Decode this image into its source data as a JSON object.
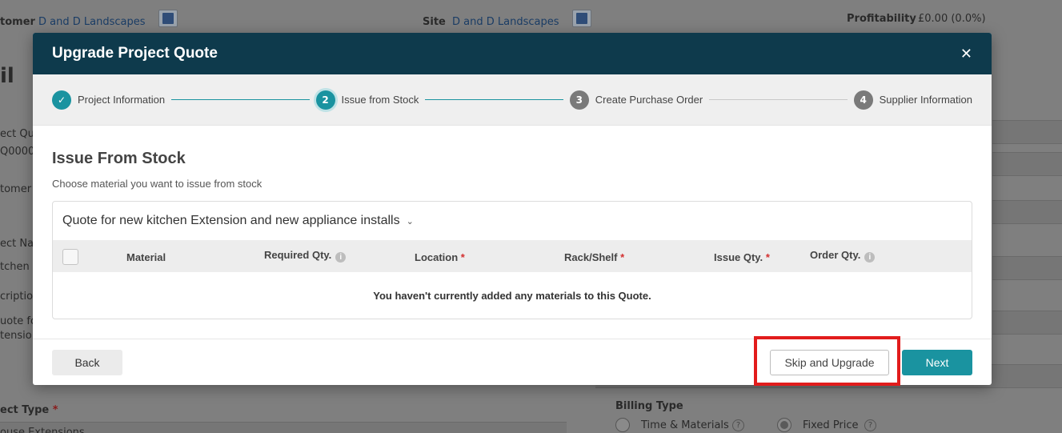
{
  "background": {
    "customer_label": "tomer",
    "customer_value": "D and D Landscapes",
    "site_label": "Site",
    "site_value": "D and D Landscapes",
    "profitability_label": "Profitability",
    "profitability_value": "£0.00 (0.0%)",
    "page_heading_fragment": "il",
    "left_fields": [
      "ect Qu",
      "Q0000",
      "tomer (",
      "ect Na",
      "tchen i",
      "criptio",
      "uote fo",
      "tensio"
    ],
    "project_type_label": "ect Type",
    "project_type_value": "ouse Extensions",
    "billing_type_label": "Billing Type",
    "billing_options": [
      "Time & Materials",
      "Fixed Price"
    ],
    "billing_selected": "Fixed Price"
  },
  "modal": {
    "title": "Upgrade Project Quote",
    "close_symbol": "✕",
    "steps": [
      {
        "number": "✓",
        "label": "Project Information",
        "state": "done"
      },
      {
        "number": "2",
        "label": "Issue from Stock",
        "state": "active"
      },
      {
        "number": "3",
        "label": "Create Purchase Order",
        "state": "todo"
      },
      {
        "number": "4",
        "label": "Supplier Information",
        "state": "todo"
      }
    ],
    "section_title": "Issue From Stock",
    "section_subtitle": "Choose material you want to issue from stock",
    "quote_title": "Quote for new kitchen Extension and new appliance installs",
    "table": {
      "columns": [
        "Material",
        "Required Qty.",
        "Location",
        "Rack/Shelf",
        "Issue Qty.",
        "Order Qty."
      ],
      "required_marker": "*",
      "info_marker": "i",
      "empty_message": "You haven't currently added any materials to this Quote."
    },
    "buttons": {
      "back": "Back",
      "skip": "Skip and Upgrade",
      "next": "Next"
    }
  },
  "colors": {
    "header_bg": "#0e3a4c",
    "accent": "#1a93a0",
    "highlight": "#e21c1c"
  }
}
